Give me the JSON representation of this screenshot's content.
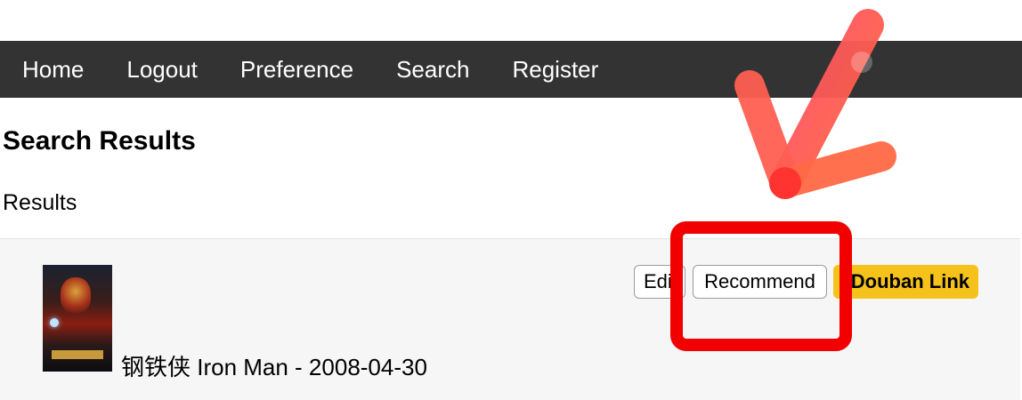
{
  "navbar": {
    "items": [
      {
        "label": "Home"
      },
      {
        "label": "Logout"
      },
      {
        "label": "Preference"
      },
      {
        "label": "Search"
      },
      {
        "label": "Register"
      }
    ]
  },
  "page": {
    "title": "Search Results",
    "results_label": "Results"
  },
  "result": {
    "movie_title": "钢铁侠 Iron Man - 2008-04-30",
    "edit_label": "Edit",
    "recommend_label": "Recommend",
    "douban_label": "Douban Link"
  },
  "annotation": {
    "highlight_color": "#f20000",
    "arrow_color": "#ff5a4a",
    "arrow_icon": "checkmark-arrow-icon",
    "highlight_target": "Recommend"
  }
}
